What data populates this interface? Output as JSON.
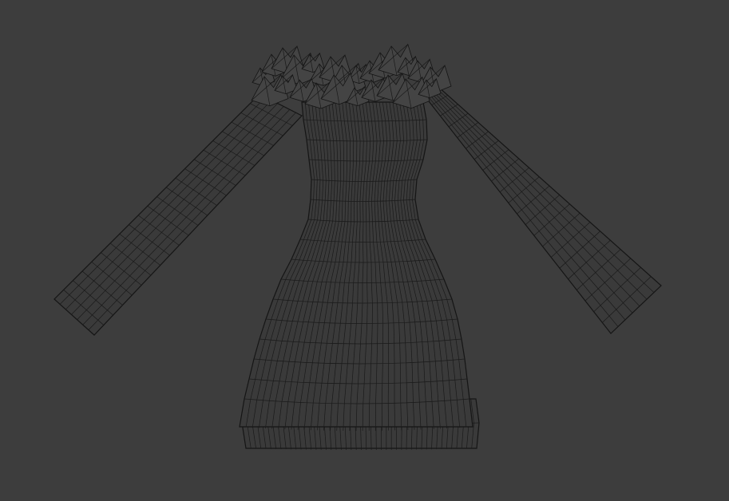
{
  "viewport": {
    "background": "#3d3d3d",
    "wire_color": "#1a1a1a",
    "shading": "wireframe",
    "object": "dress-mesh"
  }
}
